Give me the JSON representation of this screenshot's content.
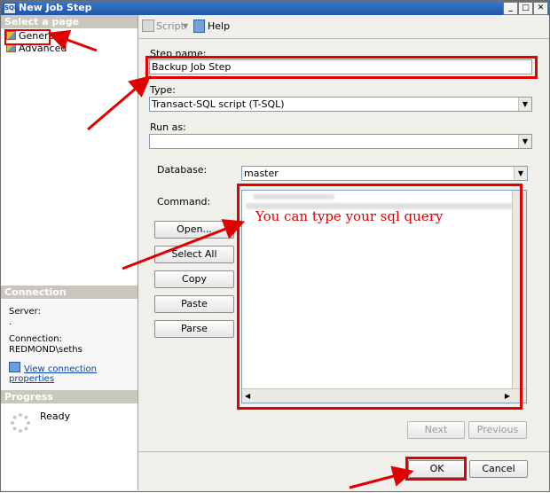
{
  "window": {
    "title": "New Job Step",
    "app_icon": "sql-agent-icon"
  },
  "left_panel": {
    "select_page_header": "Select a page",
    "pages": [
      {
        "label": "General"
      },
      {
        "label": "Advanced"
      }
    ],
    "connection_header": "Connection",
    "server_label": "Server:",
    "server_value": ".",
    "connection_label": "Connection:",
    "connection_value": "REDMOND\\seths",
    "view_connection_link": "View connection properties",
    "progress_header": "Progress",
    "progress_status": "Ready"
  },
  "toolbar": {
    "script_label": "Script",
    "help_label": "Help"
  },
  "form": {
    "step_name_label": "Step name:",
    "step_name_value": "Backup Job Step",
    "type_label": "Type:",
    "type_value": "Transact-SQL script (T-SQL)",
    "run_as_label": "Run as:",
    "run_as_value": "",
    "database_label": "Database:",
    "database_value": "master",
    "command_label": "Command:",
    "command_buttons": [
      "Open...",
      "Select All",
      "Copy",
      "Paste",
      "Parse"
    ],
    "annotation": "You can type your sql query"
  },
  "nav_buttons": {
    "next": "Next",
    "previous": "Previous"
  },
  "footer": {
    "ok": "OK",
    "cancel": "Cancel"
  },
  "colors": {
    "highlight_red": "#e00000",
    "title_blue": "#2a63b8",
    "link_blue": "#0645ad"
  }
}
